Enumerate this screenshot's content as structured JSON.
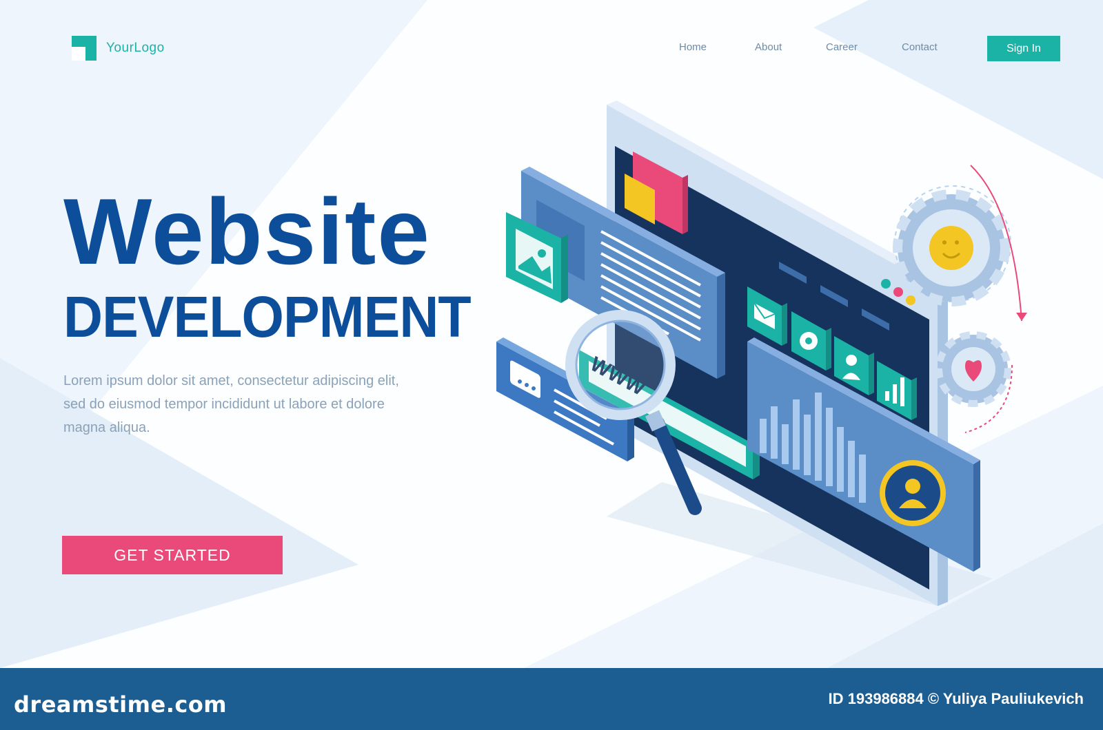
{
  "header": {
    "logo_text": "YourLogo",
    "nav": [
      "Home",
      "About",
      "Career",
      "Contact"
    ],
    "signin_label": "Sign In"
  },
  "hero": {
    "title": "Website",
    "subtitle": "DEVELOPMENT",
    "description_lines": [
      "Lorem ipsum dolor sit amet, consectetur adipiscing elit,",
      "sed do eiusmod tempor incididunt ut labore et dolore",
      "magna aliqua."
    ],
    "cta_label": "GET STARTED"
  },
  "illustration": {
    "search_text": "WWW"
  },
  "footer": {
    "brand": "dreamstime.com",
    "credit": "ID 193986884 © Yuliya Pauliukevich"
  },
  "colors": {
    "accent": "#1bb3a6",
    "primary": "#0d4e9b",
    "cta": "#e94a7a",
    "footer": "#1c5e92"
  }
}
